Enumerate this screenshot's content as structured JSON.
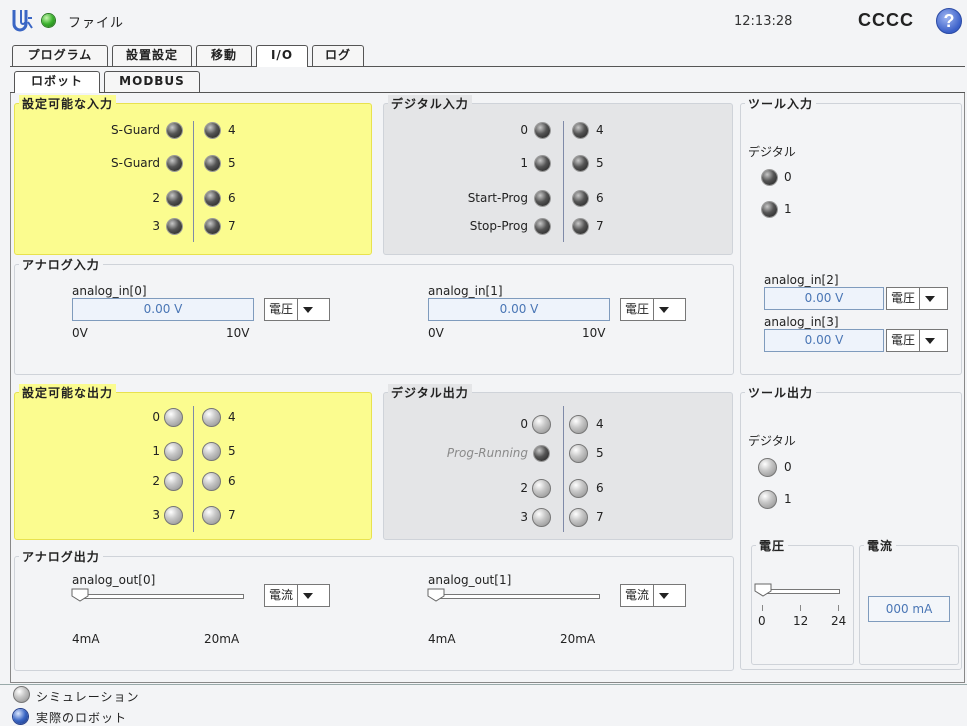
{
  "header": {
    "title": "ファイル",
    "clock": "12:13:28",
    "robot_name": "CCCC",
    "help": "?"
  },
  "main_tabs": [
    {
      "label": "プログラム"
    },
    {
      "label": "設置設定"
    },
    {
      "label": "移動"
    },
    {
      "label": "I/O",
      "active": true
    },
    {
      "label": "ログ"
    }
  ],
  "sub_tabs": [
    {
      "label": "ロボット",
      "active": true
    },
    {
      "label": "MODBUS"
    }
  ],
  "configurable_inputs": {
    "title": "設定可能な入力",
    "left": [
      "S-Guard",
      "S-Guard",
      "2",
      "3"
    ],
    "right": [
      "4",
      "5",
      "6",
      "7"
    ]
  },
  "digital_inputs": {
    "title": "デジタル入力",
    "left": [
      "0",
      "1",
      "Start-Prog",
      "Stop-Prog"
    ],
    "right": [
      "4",
      "5",
      "6",
      "7"
    ]
  },
  "tool_inputs": {
    "title": "ツール入力",
    "digital_label": "デジタル",
    "digital": [
      "0",
      "1"
    ],
    "analog": [
      {
        "name": "analog_in[2]",
        "value": "0.00 V",
        "mode": "電圧"
      },
      {
        "name": "analog_in[3]",
        "value": "0.00 V",
        "mode": "電圧"
      }
    ]
  },
  "analog_inputs": {
    "title": "アナログ入力",
    "items": [
      {
        "name": "analog_in[0]",
        "value": "0.00 V",
        "mode": "電圧",
        "min": "0V",
        "max": "10V"
      },
      {
        "name": "analog_in[1]",
        "value": "0.00 V",
        "mode": "電圧",
        "min": "0V",
        "max": "10V"
      }
    ]
  },
  "configurable_outputs": {
    "title": "設定可能な出力",
    "left": [
      "0",
      "1",
      "2",
      "3"
    ],
    "right": [
      "4",
      "5",
      "6",
      "7"
    ]
  },
  "digital_outputs": {
    "title": "デジタル出力",
    "left": [
      "0",
      "Prog-Running",
      "2",
      "3"
    ],
    "right": [
      "4",
      "5",
      "6",
      "7"
    ]
  },
  "tool_outputs": {
    "title": "ツール出力",
    "digital_label": "デジタル",
    "digital": [
      "0",
      "1"
    ],
    "voltage_title": "電圧",
    "voltage_ticks": [
      "0",
      "12",
      "24"
    ],
    "current_title": "電流",
    "current_value": "000 mA"
  },
  "analog_outputs": {
    "title": "アナログ出力",
    "items": [
      {
        "name": "analog_out[0]",
        "mode": "電流",
        "min": "4mA",
        "max": "20mA",
        "level": 0
      },
      {
        "name": "analog_out[1]",
        "mode": "電流",
        "min": "4mA",
        "max": "20mA",
        "level": 0
      }
    ]
  },
  "footer": {
    "simulation": "シミュレーション",
    "real_robot": "実際のロボット"
  },
  "colors": {
    "configurable_bg": "#fbfc8f",
    "digital_bg": "#e4e5e7",
    "field_text": "#4a76b5"
  }
}
